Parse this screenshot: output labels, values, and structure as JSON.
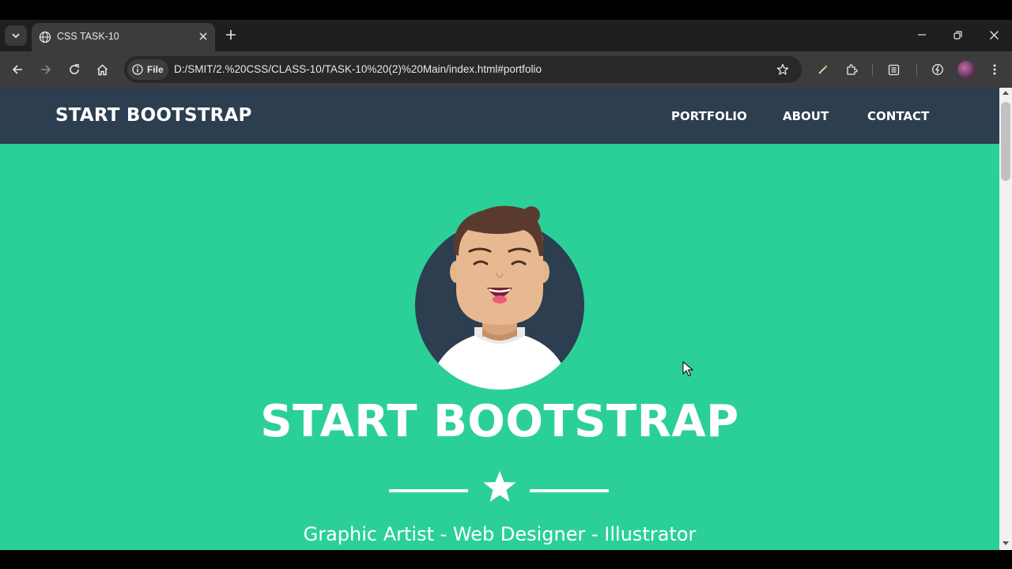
{
  "browser": {
    "tab": {
      "title": "CSS TASK-10"
    },
    "omnibox": {
      "site_chip": "File",
      "url": "D:/SMIT/2.%20CSS/CLASS-10/TASK-10%20(2)%20Main/index.html#portfolio"
    }
  },
  "site": {
    "brand": "START BOOTSTRAP",
    "nav": [
      "PORTFOLIO",
      "ABOUT",
      "CONTACT"
    ],
    "hero": {
      "title": "START BOOTSTRAP",
      "subtitle": "Graphic Artist - Web Designer - Illustrator"
    }
  },
  "colors": {
    "hero_bg": "#2bd099",
    "nav_bg": "#2c3e50",
    "avatar_circle": "#2c3e50"
  }
}
